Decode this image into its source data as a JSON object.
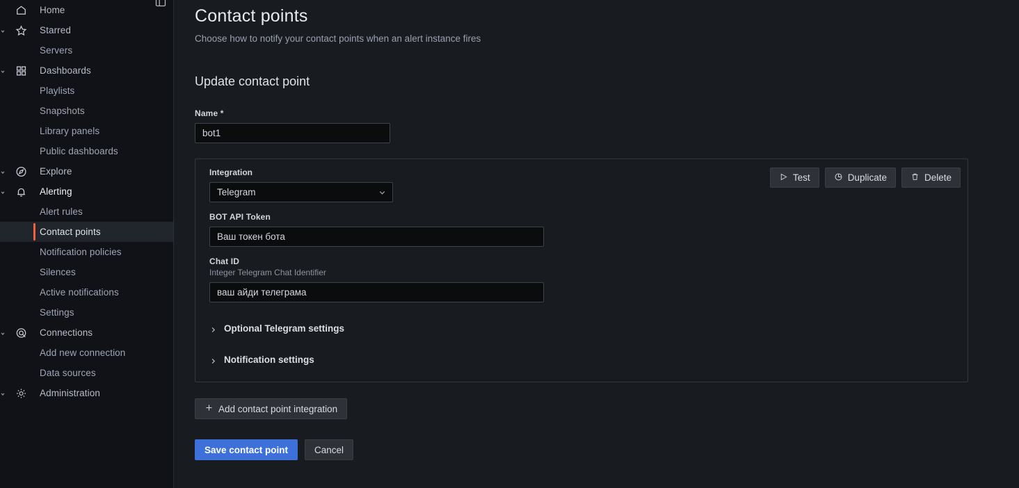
{
  "sidebar": {
    "dock_icon": "dock-menu-icon",
    "items": [
      {
        "label": "Home",
        "icon": "home-icon",
        "indent": false,
        "expandable": false,
        "state": "parent"
      },
      {
        "label": "Starred",
        "icon": "star-icon",
        "indent": false,
        "expandable": true,
        "state": "parent"
      },
      {
        "label": "Servers",
        "icon": "",
        "indent": true,
        "expandable": false,
        "state": "child"
      },
      {
        "label": "Dashboards",
        "icon": "dashboards-icon",
        "indent": false,
        "expandable": true,
        "state": "parent"
      },
      {
        "label": "Playlists",
        "icon": "",
        "indent": true,
        "expandable": false,
        "state": "child"
      },
      {
        "label": "Snapshots",
        "icon": "",
        "indent": true,
        "expandable": false,
        "state": "child"
      },
      {
        "label": "Library panels",
        "icon": "",
        "indent": true,
        "expandable": false,
        "state": "child"
      },
      {
        "label": "Public dashboards",
        "icon": "",
        "indent": true,
        "expandable": false,
        "state": "child"
      },
      {
        "label": "Explore",
        "icon": "compass-icon",
        "indent": false,
        "expandable": true,
        "state": "parent"
      },
      {
        "label": "Alerting",
        "icon": "bell-icon",
        "indent": false,
        "expandable": true,
        "state": "active-parent"
      },
      {
        "label": "Alert rules",
        "icon": "",
        "indent": true,
        "expandable": false,
        "state": "child"
      },
      {
        "label": "Contact points",
        "icon": "",
        "indent": true,
        "expandable": false,
        "state": "selected"
      },
      {
        "label": "Notification policies",
        "icon": "",
        "indent": true,
        "expandable": false,
        "state": "child"
      },
      {
        "label": "Silences",
        "icon": "",
        "indent": true,
        "expandable": false,
        "state": "child"
      },
      {
        "label": "Active notifications",
        "icon": "",
        "indent": true,
        "expandable": false,
        "state": "child"
      },
      {
        "label": "Settings",
        "icon": "",
        "indent": true,
        "expandable": false,
        "state": "child"
      },
      {
        "label": "Connections",
        "icon": "connections-icon",
        "indent": false,
        "expandable": true,
        "state": "parent"
      },
      {
        "label": "Add new connection",
        "icon": "",
        "indent": true,
        "expandable": false,
        "state": "child"
      },
      {
        "label": "Data sources",
        "icon": "",
        "indent": true,
        "expandable": false,
        "state": "child"
      },
      {
        "label": "Administration",
        "icon": "gear-icon",
        "indent": false,
        "expandable": true,
        "state": "parent"
      }
    ]
  },
  "page": {
    "title": "Contact points",
    "subtitle": "Choose how to notify your contact points when an alert instance fires",
    "section_title": "Update contact point"
  },
  "form": {
    "name_label": "Name *",
    "name_value": "bot1",
    "integration_label": "Integration",
    "integration_value": "Telegram",
    "bot_token_label": "BOT API Token",
    "bot_token_value": "Ваш токен бота",
    "chat_id_label": "Chat ID",
    "chat_id_desc": "Integer Telegram Chat Identifier",
    "chat_id_value": "ваш айди телеграма",
    "optional_section": "Optional Telegram settings",
    "notification_section": "Notification settings"
  },
  "actions": {
    "test": "Test",
    "duplicate": "Duplicate",
    "delete": "Delete",
    "add_integration": "Add contact point integration",
    "save": "Save contact point",
    "cancel": "Cancel"
  },
  "colors": {
    "accent_orange": "#f55f3e",
    "primary_blue": "#3d71d9",
    "page_bg": "#181b1f",
    "sidebar_bg": "#111217"
  }
}
